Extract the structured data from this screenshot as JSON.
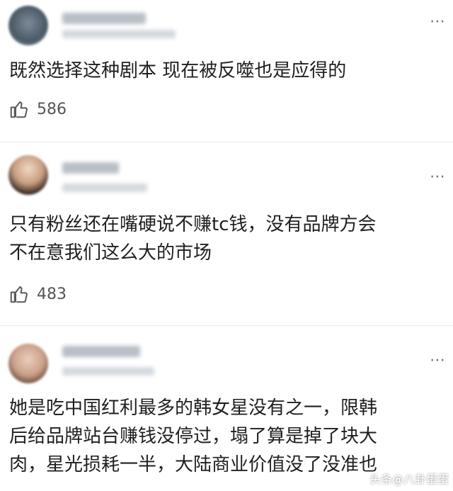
{
  "comments": [
    {
      "text": "既然选择这种剧本  现在被反噬也是应得的",
      "likes": "586",
      "more_icon": "⋯"
    },
    {
      "text": "只有粉丝还在嘴硬说不赚tc钱，没有品牌方会\n不在意我们这么大的市场",
      "likes": "483",
      "more_icon": "⋯"
    },
    {
      "text": "她是吃中国红利最多的韩女星没有之一，限韩\n后给品牌站台赚钱没停过，塌了算是掉了块大\n肉，星光损耗一半，大陆商业价值没了没准也",
      "more_icon": "⋯"
    }
  ],
  "watermark": "头条@八卦蛋蛋"
}
